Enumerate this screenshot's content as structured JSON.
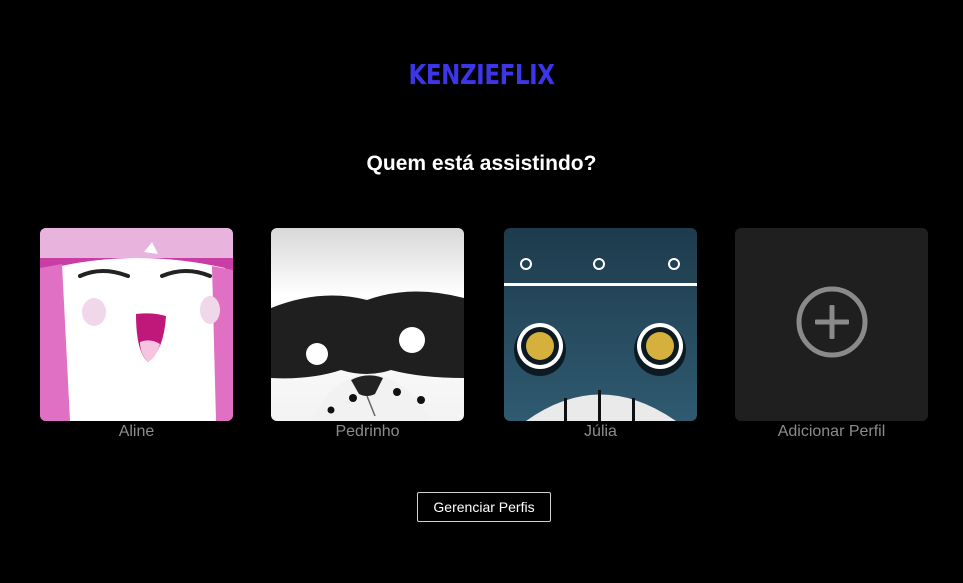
{
  "app": {
    "logo_text": "KENZIEFLIX",
    "brand_color": "#3d35e8"
  },
  "headline": "Quem está assistindo?",
  "profiles": [
    {
      "name": "Aline",
      "avatar": "pink-smiling-character"
    },
    {
      "name": "Pedrinho",
      "avatar": "masked-raccoon-character"
    },
    {
      "name": "Júlia",
      "avatar": "teal-robot-character"
    }
  ],
  "add_profile": {
    "label": "Adicionar Perfil",
    "icon": "plus-circle-icon"
  },
  "manage_button": {
    "label": "Gerenciar Perfis"
  }
}
